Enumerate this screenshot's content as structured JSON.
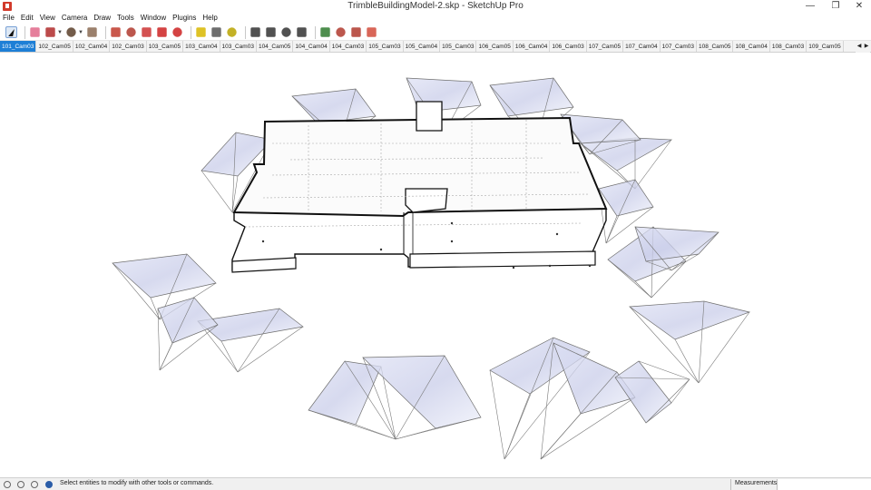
{
  "window": {
    "title": "TrimbleBuildingModel-2.skp - SketchUp Pro",
    "minimize": "—",
    "maximize": "❐",
    "close": "✕"
  },
  "menu": [
    "File",
    "Edit",
    "View",
    "Camera",
    "Draw",
    "Tools",
    "Window",
    "Plugins",
    "Help"
  ],
  "toolbar": {
    "tools": [
      {
        "name": "select-tool-icon",
        "color": "#1a1a1a"
      },
      {
        "name": "eraser-tool-icon",
        "color": "#e0678a"
      },
      {
        "name": "pencil-tool-icon",
        "color": "#b02b2b"
      },
      {
        "name": "arc-tool-icon",
        "color": "#5a3f2a"
      },
      {
        "name": "shape-tool-icon",
        "color": "#8a6a52"
      },
      {
        "name": "push-pull-tool-icon",
        "color": "#c0392b"
      },
      {
        "name": "follow-me-tool-icon",
        "color": "#b03a2e"
      },
      {
        "name": "move-tool-icon",
        "color": "#cc3333"
      },
      {
        "name": "rotate-tool-icon",
        "color": "#cc2222"
      },
      {
        "name": "scale-tool-icon",
        "color": "#cc2222"
      },
      {
        "name": "tape-measure-tool-icon",
        "color": "#d8b700"
      },
      {
        "name": "dimension-tool-icon",
        "color": "#555555"
      },
      {
        "name": "text-tool-icon",
        "color": "#b9a300"
      },
      {
        "name": "orbit-tool-icon",
        "color": "#333333"
      },
      {
        "name": "pan-tool-icon",
        "color": "#333333"
      },
      {
        "name": "zoom-tool-icon",
        "color": "#333333"
      },
      {
        "name": "zoom-extents-tool-icon",
        "color": "#333333"
      },
      {
        "name": "layout-tool-icon",
        "color": "#2f7a2f"
      },
      {
        "name": "warehouse-tool-icon",
        "color": "#b03a2e"
      },
      {
        "name": "extension-warehouse-tool-icon",
        "color": "#b03a2e"
      },
      {
        "name": "send-to-layout-tool-icon",
        "color": "#d24b3b"
      }
    ]
  },
  "scene_tabs": [
    "101_Cam03",
    "102_Cam05",
    "102_Cam04",
    "102_Cam03",
    "103_Cam05",
    "103_Cam04",
    "103_Cam03",
    "104_Cam05",
    "104_Cam04",
    "104_Cam03",
    "105_Cam03",
    "105_Cam04",
    "105_Cam03",
    "106_Cam05",
    "106_Cam04",
    "106_Cam03",
    "107_Cam05",
    "107_Cam04",
    "107_Cam03",
    "108_Cam05",
    "108_Cam04",
    "108_Cam03",
    "109_Cam05"
  ],
  "active_tab_index": 0,
  "tab_scroll": {
    "left": "◀",
    "right": "▶"
  },
  "status": {
    "message": "Select entities to modify with other tools or commands.",
    "measurements_label": "Measurements",
    "measurements_value": ""
  },
  "colors": {
    "active_tab": "#1e7fd6",
    "building_edge": "#111111",
    "camera_frustum": "#6f6f6f",
    "photo_tint": "#cfd3ee"
  }
}
